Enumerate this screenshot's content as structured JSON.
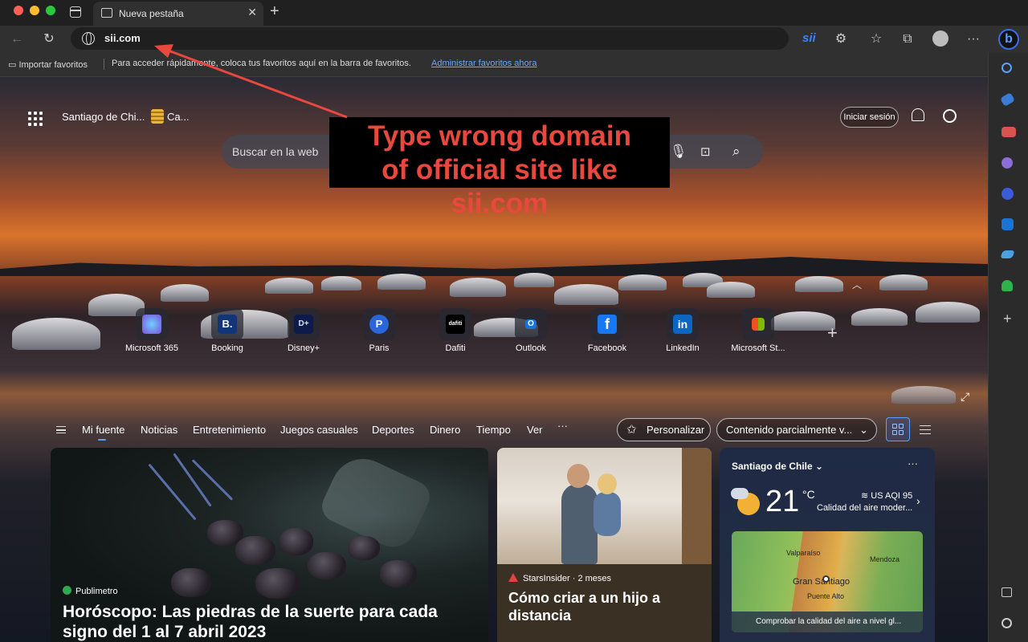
{
  "browser": {
    "tab_title": "Nueva pestaña",
    "url": "sii.com",
    "extension_label": "sii",
    "bing_label": "b"
  },
  "favorites_bar": {
    "import_label": "Importar favoritos",
    "hint": "Para acceder rápidamente, coloca tus favoritos aquí en la barra de favoritos.",
    "manage_link": "Administrar favoritos ahora"
  },
  "header": {
    "location": "Santiago de Chi...",
    "weather_short": "Ca...",
    "login_label": "Iniciar sesión"
  },
  "search": {
    "placeholder": "Buscar en la web"
  },
  "annotation": {
    "line1": "Type wrong domain",
    "line2": "of official site like sii.com",
    "color": "#e8483d"
  },
  "quick_links": [
    {
      "label": "Microsoft 365",
      "icon": "microsoft-365-icon"
    },
    {
      "label": "Booking",
      "icon": "booking-icon",
      "glyph": "B."
    },
    {
      "label": "Disney+",
      "icon": "disney-plus-icon",
      "glyph": "D+"
    },
    {
      "label": "Paris",
      "icon": "paris-icon",
      "glyph": "P"
    },
    {
      "label": "Dafiti",
      "icon": "dafiti-icon",
      "glyph": "dafiti"
    },
    {
      "label": "Outlook",
      "icon": "outlook-icon",
      "glyph": "O"
    },
    {
      "label": "Facebook",
      "icon": "facebook-icon",
      "glyph": "f"
    },
    {
      "label": "LinkedIn",
      "icon": "linkedin-icon",
      "glyph": "in"
    },
    {
      "label": "Microsoft St...",
      "icon": "microsoft-store-icon"
    }
  ],
  "feed_nav": {
    "tabs": [
      "Mi fuente",
      "Noticias",
      "Entretenimiento",
      "Juegos casuales",
      "Deportes",
      "Dinero",
      "Tiempo",
      "Ver",
      "···"
    ],
    "personalize_label": "Personalizar",
    "content_filter": "Contenido parcialmente v..."
  },
  "cards": {
    "main": {
      "source": "Publimetro",
      "title": "Horóscopo: Las piedras de la suerte para cada signo del 1 al 7 abril 2023"
    },
    "second": {
      "source": "StarsInsider · 2 meses",
      "title": "Cómo criar a un hijo a distancia"
    },
    "weather": {
      "city": "Santiago de Chile",
      "temperature": "21",
      "unit": "°C",
      "aqi": "US AQI 95",
      "air_quality": "Calidad del aire moder...",
      "map_labels": {
        "valparaiso": "Valparaíso",
        "mendoza": "Mendoza",
        "santiago": "Gran Santiago",
        "puente_alto": "Puente Alto"
      },
      "map_cta": "Comprobar la calidad del aire a nivel gl..."
    }
  }
}
